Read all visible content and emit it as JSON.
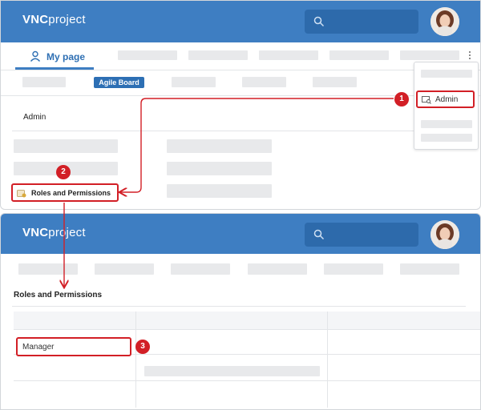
{
  "app": {
    "logo_bold": "VNC",
    "logo_light": "project"
  },
  "top": {
    "tab_my_page": "My page",
    "agile_badge": "Agile Board",
    "admin_heading": "Admin",
    "dropdown_admin": "Admin",
    "roles_link": "Roles and Permissions"
  },
  "bottom": {
    "roles_title": "Roles and Permissions",
    "manager_row": "Manager"
  },
  "steps": [
    "1",
    "2",
    "3"
  ],
  "colors": {
    "header": "#3e7ec2",
    "highlight": "#d21f26",
    "badge": "#2d6fb4"
  }
}
